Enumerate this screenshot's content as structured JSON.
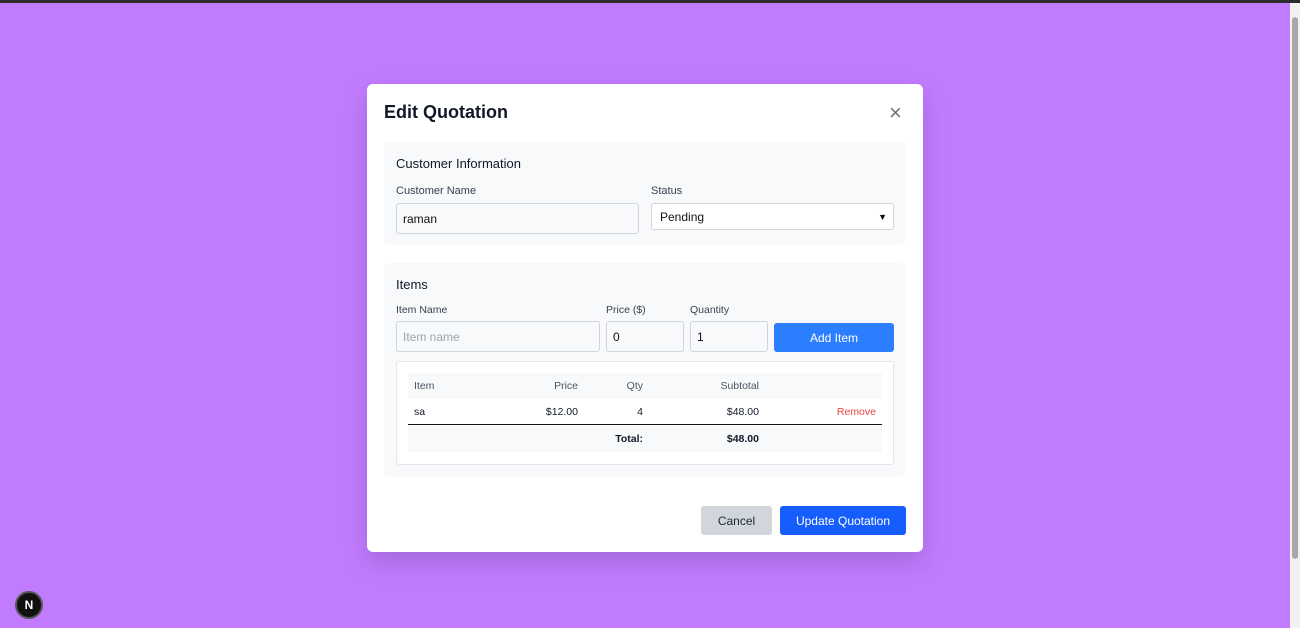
{
  "modal": {
    "title": "Edit Quotation",
    "close_icon": "×"
  },
  "customer": {
    "heading": "Customer Information",
    "name_label": "Customer Name",
    "name_value": "raman",
    "status_label": "Status",
    "status_value": "Pending"
  },
  "items": {
    "heading": "Items",
    "item_name_label": "Item Name",
    "item_name_placeholder": "Item name",
    "price_label": "Price ($)",
    "price_value": "0",
    "qty_label": "Quantity",
    "qty_value": "1",
    "add_label": "Add Item",
    "columns": [
      "Item",
      "Price",
      "Qty",
      "Subtotal"
    ],
    "rows": [
      {
        "item": "sa",
        "price": "$12.00",
        "qty": "4",
        "subtotal": "$48.00",
        "action": "Remove"
      }
    ],
    "total_label": "Total:",
    "total_value": "$48.00"
  },
  "footer": {
    "cancel": "Cancel",
    "update": "Update Quotation"
  },
  "badge": "N",
  "colors": {
    "background": "#c17bff",
    "primary": "#155dfc",
    "add": "#2b7fff",
    "remove": "#ef4444"
  }
}
